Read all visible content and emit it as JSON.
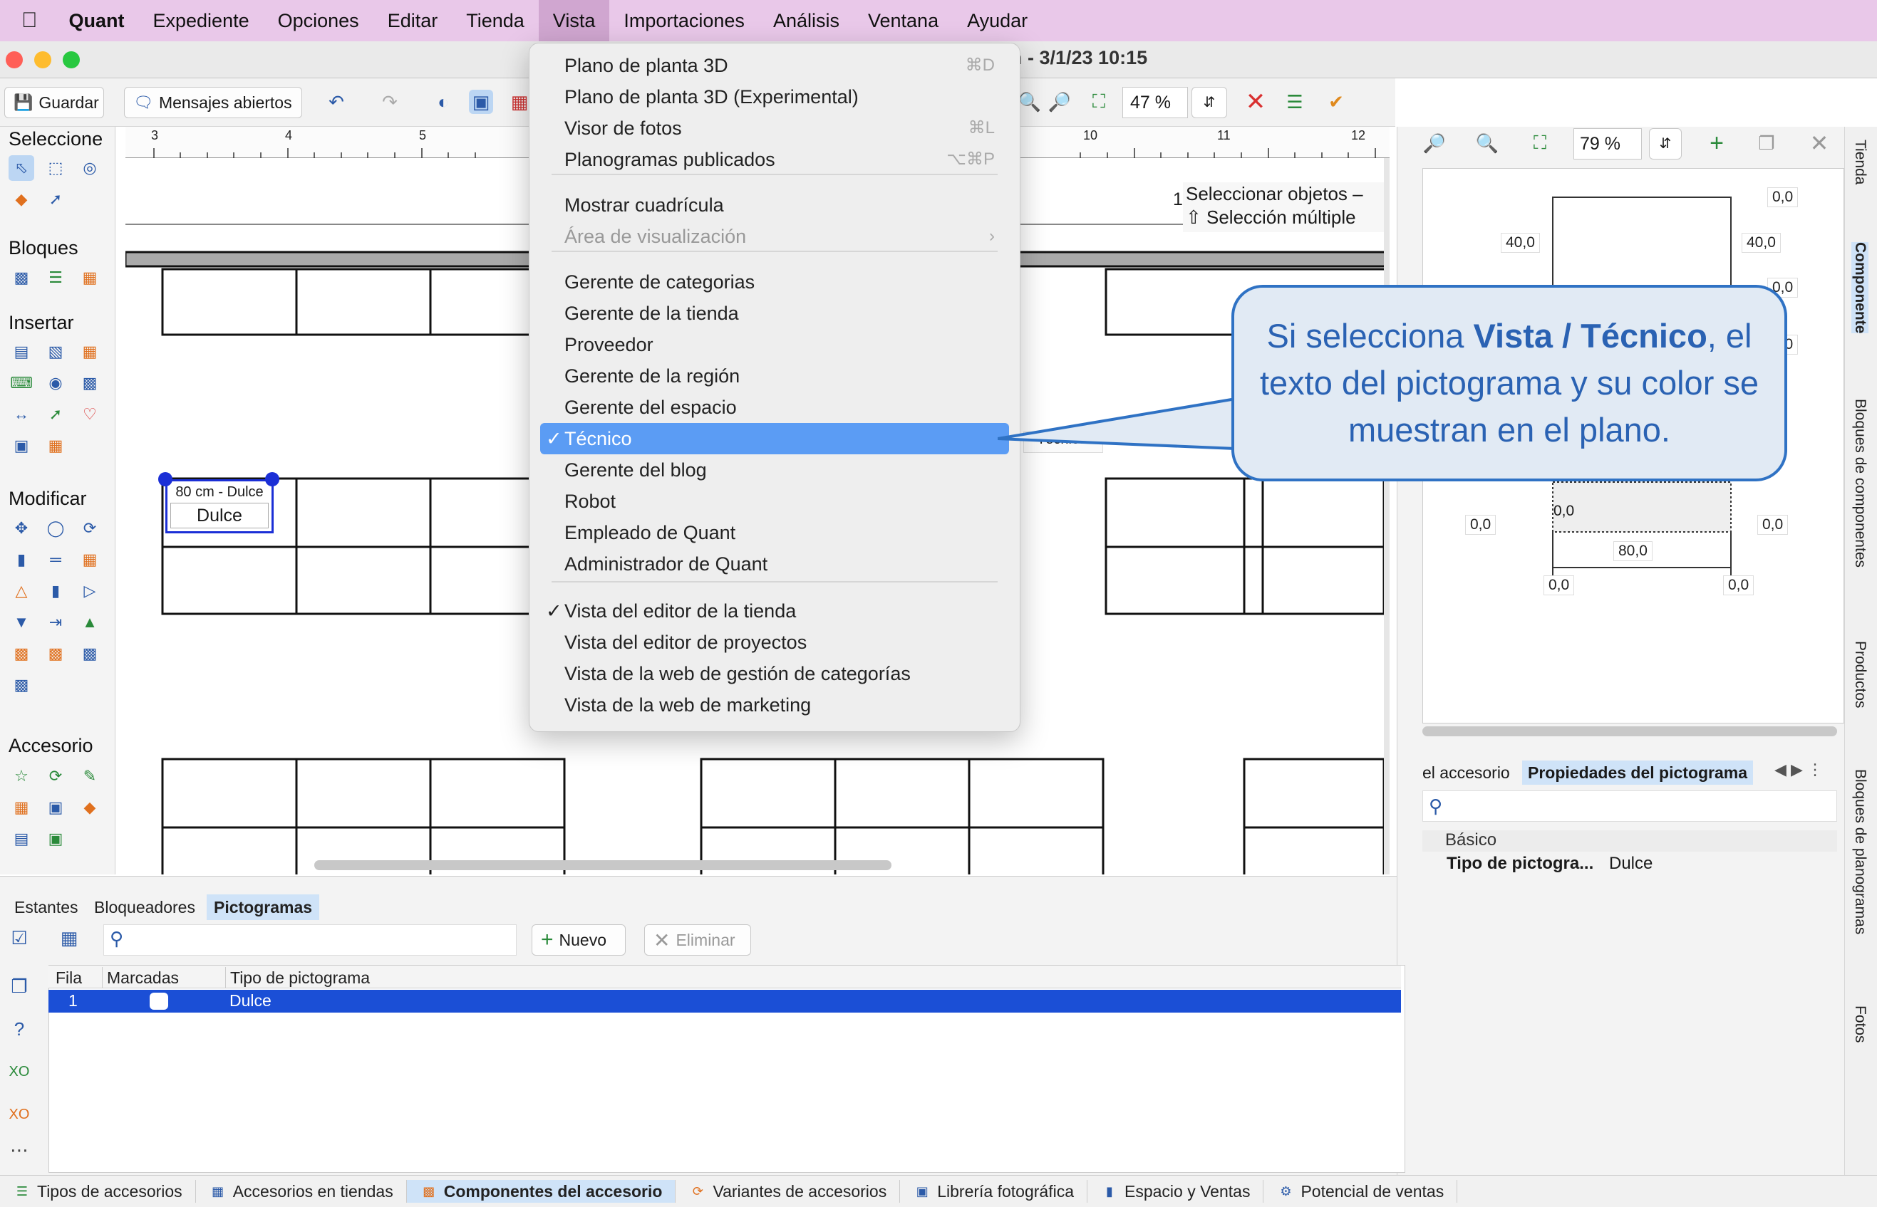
{
  "menubar": {
    "app_name": "Quant",
    "items": [
      "Expediente",
      "Opciones",
      "Editar",
      "Tienda",
      "Vista",
      "Importaciones",
      "Análisis",
      "Ventana",
      "Ayudar"
    ],
    "active": "Vista"
  },
  "window": {
    "title_fragment": "n - 3/1/23 10:15"
  },
  "toolbar": {
    "save_label": "Guardar",
    "messages_label": "Mensajes abiertos",
    "zoom_value": "47 %"
  },
  "left_palette": {
    "sections": [
      "Seleccione",
      "Bloques",
      "Insertar",
      "Modificar",
      "Accesorio"
    ]
  },
  "ruler": {
    "ticks": [
      "3",
      "4",
      "5",
      "10",
      "11",
      "12"
    ]
  },
  "canvas": {
    "tooltip_line1": "Seleccionar objetos –",
    "tooltip_line2": "⇧ Selección múltiple",
    "tooltip_prefix": "1",
    "pictogram_size": "80 cm - Dulce",
    "pictogram_label": "Dulce",
    "hidden_label": "Técnico"
  },
  "vista_menu": {
    "items": [
      {
        "label": "Plano de planta 3D",
        "shortcut": "⌘D"
      },
      {
        "label": "Plano de planta 3D (Experimental)",
        "shortcut": ""
      },
      {
        "label": "Visor de fotos",
        "shortcut": "⌘L"
      },
      {
        "label": "Planogramas publicados",
        "shortcut": "⌥⌘P"
      },
      {
        "label": "Mostrar cuadrícula",
        "shortcut": ""
      },
      {
        "label": "Área de visualización",
        "shortcut": "›",
        "disabled": true
      },
      {
        "label": "Gerente de categorias",
        "shortcut": ""
      },
      {
        "label": "Gerente de la tienda",
        "shortcut": ""
      },
      {
        "label": "Proveedor",
        "shortcut": ""
      },
      {
        "label": "Gerente de la región",
        "shortcut": ""
      },
      {
        "label": "Gerente del espacio",
        "shortcut": ""
      },
      {
        "label": "Técnico",
        "shortcut": "",
        "checked": true,
        "selected": true
      },
      {
        "label": "Gerente del blog",
        "shortcut": ""
      },
      {
        "label": "Robot",
        "shortcut": ""
      },
      {
        "label": "Empleado de Quant",
        "shortcut": ""
      },
      {
        "label": "Administrador de Quant",
        "shortcut": ""
      },
      {
        "label": "Vista del editor de la tienda",
        "shortcut": "",
        "checked": true
      },
      {
        "label": "Vista del editor de proyectos",
        "shortcut": ""
      },
      {
        "label": "Vista de la web de gestión de categorías",
        "shortcut": ""
      },
      {
        "label": "Vista de la web de marketing",
        "shortcut": ""
      }
    ]
  },
  "callout": {
    "text_before": "Si selecciona ",
    "bold": "Vista / Técnico",
    "text_after": ", el texto del pictograma y su color se muestran en el plano."
  },
  "right_panel": {
    "zoom_value": "79 %",
    "dims": [
      "0,0",
      "40,0",
      "40,0",
      "0,0",
      "0,0",
      "0,0",
      "0,0",
      "0,0",
      "80,0",
      "0,0",
      "0,0"
    ],
    "tabs": [
      "el accesorio",
      "Propiedades del pictograma"
    ],
    "section": "Básico",
    "prop_name": "Tipo de pictogra...",
    "prop_value": "Dulce"
  },
  "side_tabs": [
    "Tienda",
    "Componente",
    "Bloques de componentes",
    "Productos",
    "Bloques de planogramas",
    "Fotos"
  ],
  "bottom": {
    "tabs": [
      "Estantes",
      "Bloqueadores",
      "Pictogramas"
    ],
    "active_tab": "Pictogramas",
    "new_label": "Nuevo",
    "delete_label": "Eliminar",
    "columns": [
      "Fila",
      "Marcadas",
      "Tipo de pictograma"
    ],
    "rows": [
      {
        "fila": "1",
        "tipo": "Dulce"
      }
    ]
  },
  "statusbar": {
    "items": [
      "Tipos de accesorios",
      "Accesorios en tiendas",
      "Componentes del accesorio",
      "Variantes de accesorios",
      "Librería fotográfica",
      "Espacio y Ventas",
      "Potencial de ventas"
    ],
    "active": "Componentes del accesorio"
  },
  "colors": {
    "menubar": "#e9c8e9",
    "selection": "#5b9cf4",
    "callout_border": "#2f72c4",
    "grid_selection": "#1b4fd6",
    "close": "#ff5f57",
    "minimize": "#febc2e",
    "zoom": "#28c840"
  }
}
